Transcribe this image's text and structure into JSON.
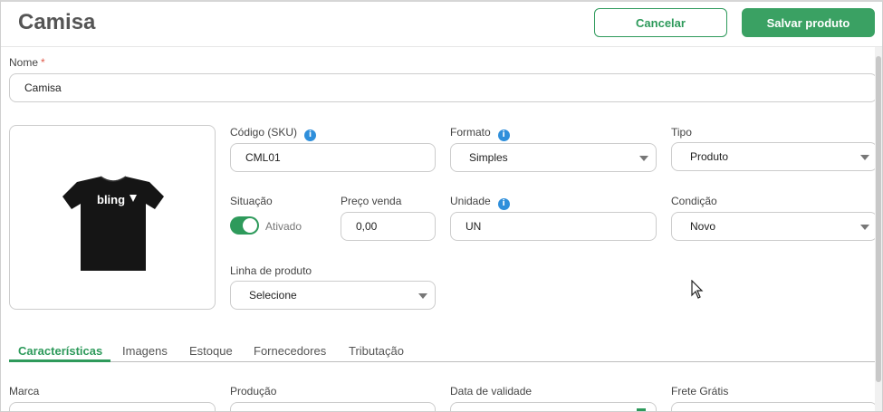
{
  "header": {
    "title": "Camisa",
    "cancel_label": "Cancelar",
    "save_label": "Salvar produto"
  },
  "form": {
    "nome": {
      "label": "Nome",
      "required_mark": "*",
      "value": "Camisa"
    },
    "sku": {
      "label": "Código (SKU)",
      "value": "CML01"
    },
    "formato": {
      "label": "Formato",
      "value": "Simples"
    },
    "tipo": {
      "label": "Tipo",
      "value": "Produto"
    },
    "situacao": {
      "label": "Situação",
      "toggle_label": "Ativado",
      "on": true
    },
    "preco": {
      "label": "Preço venda",
      "value": "0,00"
    },
    "unidade": {
      "label": "Unidade",
      "value": "UN"
    },
    "condicao": {
      "label": "Condição",
      "value": "Novo"
    },
    "linha": {
      "label": "Linha de produto",
      "value": "Selecione"
    },
    "info_glyph": "i"
  },
  "product_image": {
    "logo_text": "bling"
  },
  "tabs": [
    {
      "label": "Características",
      "active": true
    },
    {
      "label": "Imagens"
    },
    {
      "label": "Estoque"
    },
    {
      "label": "Fornecedores"
    },
    {
      "label": "Tributação"
    }
  ],
  "bottom_fields": {
    "marca": "Marca",
    "producao": "Produção",
    "validade": "Data de validade",
    "frete": "Frete Grátis"
  },
  "colors": {
    "accent": "#2e9a5b",
    "info": "#2f8fdb"
  }
}
